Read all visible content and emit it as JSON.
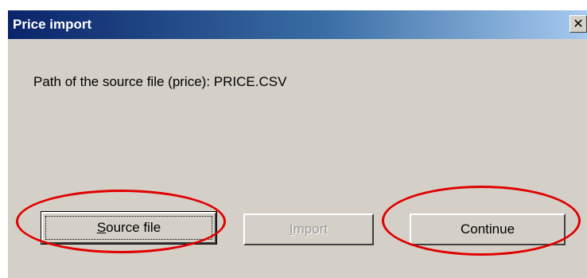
{
  "window": {
    "title": "Price import",
    "close_glyph": "✕"
  },
  "content": {
    "path_label": "Path of the source file (price): PRICE.CSV"
  },
  "buttons": {
    "source_file": {
      "accel": "S",
      "rest": "ource file"
    },
    "import": {
      "accel": "I",
      "rest": "mport",
      "enabled": false
    },
    "continue": {
      "label": "Continue"
    }
  },
  "annotations": {
    "highlight_color": "#e00000"
  },
  "colors": {
    "titlebar_start": "#0a246a",
    "titlebar_end": "#a6caf0",
    "face": "#d4d0c8"
  }
}
